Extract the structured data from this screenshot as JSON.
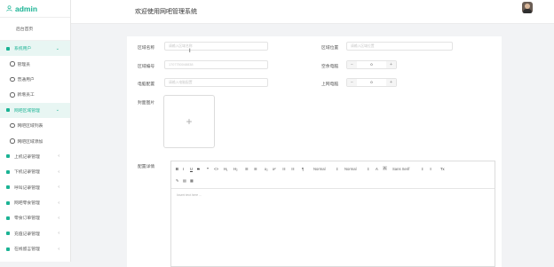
{
  "brand": {
    "name": "admin"
  },
  "header": {
    "title": "欢迎使用网吧管理系统"
  },
  "sidebar": {
    "home": "后台首页",
    "groups": [
      {
        "label": "系统用户",
        "active": true,
        "chev": "⌄",
        "children": [
          "管理员",
          "普通用户",
          "新增员工"
        ]
      },
      {
        "label": "网吧区域管理",
        "active": true,
        "chev": "⌄",
        "children": [
          "网吧区域列表",
          "网吧区域添加"
        ]
      },
      {
        "label": "上机记录管理",
        "active": false,
        "chev": "‹"
      },
      {
        "label": "下机记录管理",
        "active": false,
        "chev": "‹"
      },
      {
        "label": "呼叫记录管理",
        "active": false,
        "chev": "‹"
      },
      {
        "label": "网吧零食管理",
        "active": false,
        "chev": "‹"
      },
      {
        "label": "零食订单管理",
        "active": false,
        "chev": "‹"
      },
      {
        "label": "充值记录管理",
        "active": false,
        "chev": "‹"
      },
      {
        "label": "在线留言管理",
        "active": false,
        "chev": "‹"
      }
    ]
  },
  "form": {
    "area_name": {
      "label": "区域名称",
      "placeholder": "请输入区域名称"
    },
    "area_location": {
      "label": "区域位置",
      "placeholder": "请输入区域位置"
    },
    "area_code": {
      "label": "区域编号",
      "placeholder": "1707750048838"
    },
    "free_pc": {
      "label": "空余电脑",
      "value": "0",
      "minus": "−",
      "plus": "+"
    },
    "pc_config": {
      "label": "电脑配置",
      "placeholder": "请输入电脑配置"
    },
    "online_pc": {
      "label": "上网电脑",
      "value": "0",
      "minus": "−",
      "plus": "+"
    },
    "area_image": {
      "label": "封面图片",
      "plus": "+"
    },
    "detail": {
      "label": "配置详情"
    }
  },
  "editor": {
    "toolbar": {
      "bold": "B",
      "italic": "I",
      "underline": "U",
      "strike": "S",
      "quote": "❞",
      "code": "<>",
      "h1": "H₁",
      "h2": "H₂",
      "ol": "☰",
      "ul": "☰",
      "sub": "x₂",
      "sup": "x²",
      "indent_left": "☷",
      "indent_right": "☷",
      "direction": "¶",
      "size": "Normal",
      "header": "Normal",
      "color": "A",
      "bg": "A",
      "font": "Sans Serif",
      "align": "≡",
      "clean": "Tx",
      "link": "✎",
      "image": "▤",
      "video": "▦"
    },
    "placeholder": "Insert text here ..."
  },
  "cursor_glyph": "I",
  "colors": {
    "accent": "#1ab394",
    "active_bg": "#e8f6f3"
  }
}
